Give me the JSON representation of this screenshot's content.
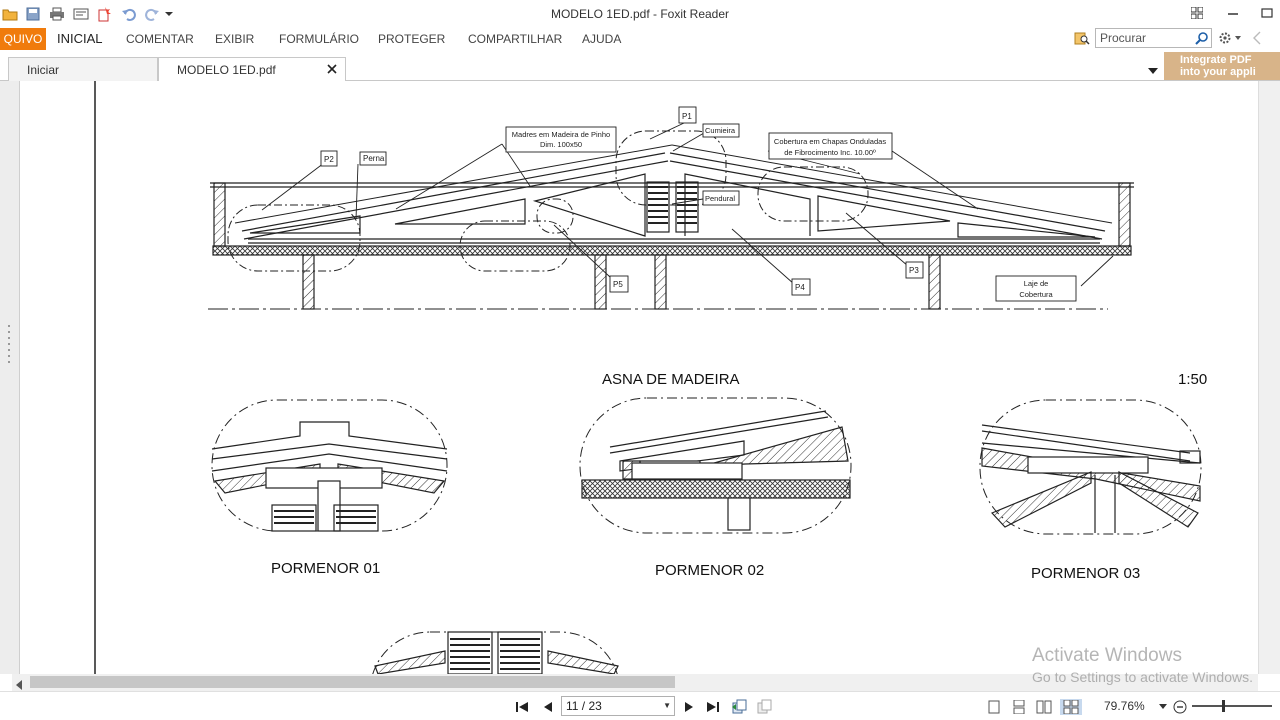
{
  "window": {
    "title": "MODELO 1ED.pdf - Foxit Reader"
  },
  "ribbon": {
    "file_tab": "QUIVO",
    "tabs": [
      "INICIAL",
      "COMENTAR",
      "EXIBIR",
      "FORMULÁRIO",
      "PROTEGER",
      "COMPARTILHAR",
      "AJUDA"
    ],
    "search_placeholder": "Procurar"
  },
  "doc_tabs": [
    "Iniciar",
    "MODELO 1ED.pdf"
  ],
  "banner": "Integrate PDF\ninto your appli",
  "drawing": {
    "labels": {
      "p1": "P1",
      "p2": "P2",
      "p3": "P3",
      "p4": "P4",
      "p5": "P5",
      "perna": "Perna",
      "madres": "Madres em Madeira de Pinho",
      "madres_dim": "Dim. 100x50",
      "cumieira": "Cumieira",
      "cobertura_l1": "Cobertura em Chapas Onduladas",
      "cobertura_l2": "de Fibrocimento Inc. 10.00º",
      "pendural": "Pendural",
      "laje_l1": "Laje de",
      "laje_l2": "Cobertura"
    },
    "title": "ASNA DE MADEIRA",
    "scale": "1:50",
    "details": [
      "PORMENOR 01",
      "PORMENOR 02",
      "PORMENOR 03"
    ]
  },
  "status": {
    "page_indicator": "11 / 23",
    "zoom": "79.76%"
  },
  "watermark": {
    "line1": "Activate Windows",
    "line2": "Go to Settings to activate Windows."
  }
}
